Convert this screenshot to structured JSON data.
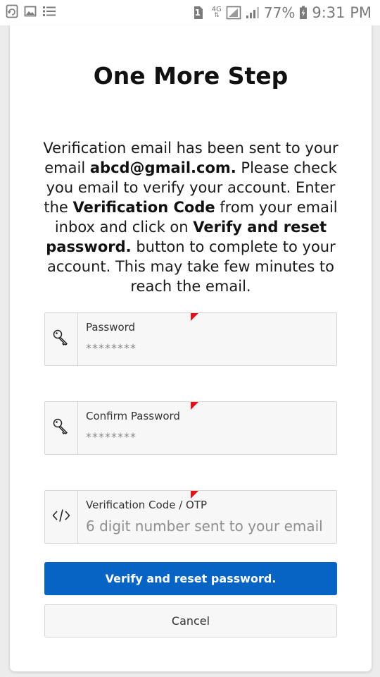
{
  "status_bar": {
    "left_icons": [
      "sync-icon",
      "image-icon",
      "list-icon"
    ],
    "sim_badge": "1",
    "network": "4G",
    "battery_percent": "77%",
    "time": "9:31 PM"
  },
  "page": {
    "title": "One More Step",
    "message": {
      "p1": "Verification email has been sent to your email ",
      "email": "abcd@gmail.com.",
      "p2": " Please check you email to verify your account. Enter the ",
      "code_term": "Verification Code",
      "p3": " from your email inbox and click on ",
      "button_term": "Verify and reset password.",
      "p4": " button to complete to your account. This may take few minutes to reach the email."
    }
  },
  "form": {
    "password": {
      "label": "Password",
      "value": "********",
      "icon": "key-icon"
    },
    "confirm_password": {
      "label": "Confirm Password",
      "value": "********",
      "icon": "key-icon"
    },
    "otp": {
      "label": "Verification Code / OTP",
      "placeholder": "6 digit number sent to your email",
      "icon": "code-icon"
    }
  },
  "buttons": {
    "verify_label": "Verify and reset password.",
    "cancel_label": "Cancel"
  },
  "colors": {
    "primary": "#0764c4",
    "required_marker": "#e0131a"
  }
}
